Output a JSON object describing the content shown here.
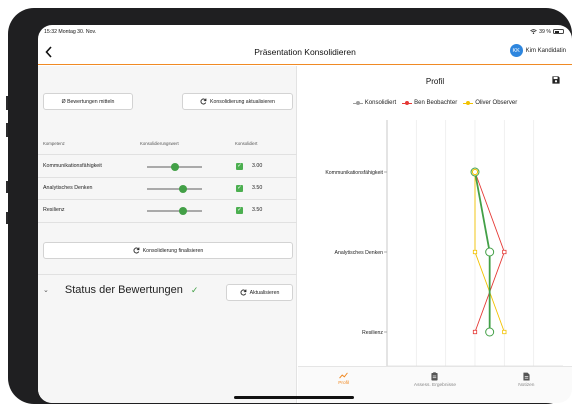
{
  "status_bar": {
    "time": "15:32  Montag 30. Nov.",
    "battery": "39 %"
  },
  "nav": {
    "back_icon": "chevron-left-icon",
    "title": "Präsentation Konsolidieren",
    "user_initials": "KK",
    "user_name": "Kim Kandidatin"
  },
  "toolbar": {
    "average_label": "Ø  Bewertungen mitteln",
    "refresh_label": "Konsolidierung aktualisieren"
  },
  "table": {
    "headers": [
      "Kompetenz",
      "Konsolidierungswert",
      "Konsolidiert"
    ],
    "rows": [
      {
        "label": "Kommunikationsfähigkeit",
        "value": "3.00",
        "slider": 0.5,
        "checked": true
      },
      {
        "label": "Analytisches Denken",
        "value": "3.50",
        "slider": 0.65,
        "checked": true
      },
      {
        "label": "Resilienz",
        "value": "3.50",
        "slider": 0.65,
        "checked": true
      }
    ]
  },
  "finalize_label": "Konsolidierung finalisieren",
  "status": {
    "title": "Status der Bewertungen",
    "refresh_label": "Aktualisieren"
  },
  "profile": {
    "title": "Profil"
  },
  "colors": {
    "accent": "#f08a24",
    "green": "#43a047",
    "red": "#e53935",
    "yellow": "#f2c200",
    "grey": "#9e9e9e"
  },
  "chart_data": {
    "type": "line",
    "orientation": "horizontal",
    "categories": [
      "Kommunikationsfähigkeit",
      "Analytisches Denken",
      "Resilienz"
    ],
    "series": [
      {
        "name": "Konsolidiert",
        "values": [
          3.0,
          3.5,
          3.5
        ]
      },
      {
        "name": "Ben Beobachter",
        "values": [
          3.0,
          4.0,
          3.0
        ]
      },
      {
        "name": "Oliver Observer",
        "values": [
          3.0,
          3.0,
          4.0
        ]
      }
    ],
    "xlim": [
      0,
      6
    ],
    "xticks": [
      1,
      2,
      3,
      4,
      5
    ],
    "grid": true,
    "legend_position": "top"
  },
  "tabs": [
    {
      "label": "Profil",
      "icon": "chart-icon",
      "active": true
    },
    {
      "label": "Assess. Ergebnisse",
      "icon": "clipboard-icon",
      "active": false
    },
    {
      "label": "Notizen",
      "icon": "document-icon",
      "active": false
    }
  ]
}
